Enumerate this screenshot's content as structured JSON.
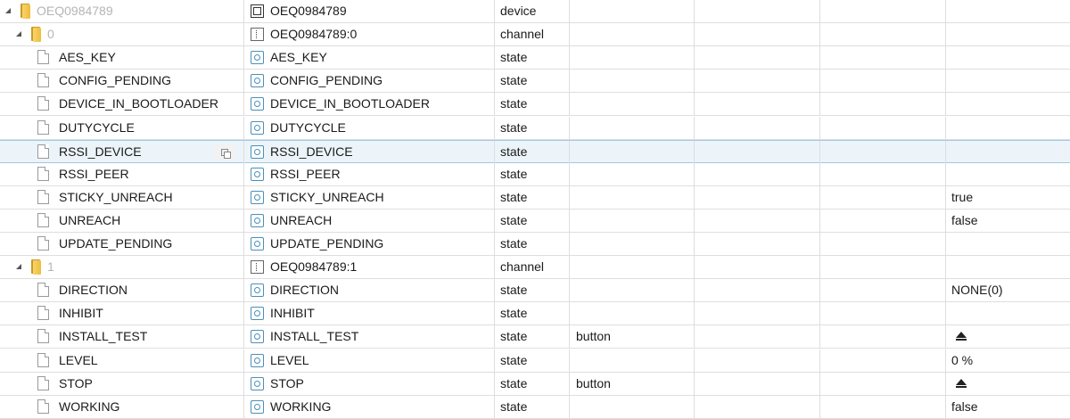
{
  "rows": [
    {
      "kind": "device",
      "name": "OEQ0984789",
      "id": "OEQ0984789",
      "type": "device",
      "role": "",
      "value": ""
    },
    {
      "kind": "channel",
      "name": "0",
      "id": "OEQ0984789:0",
      "type": "channel",
      "role": "",
      "value": ""
    },
    {
      "kind": "state",
      "name": "AES_KEY",
      "id": "AES_KEY",
      "type": "state",
      "role": "",
      "value": ""
    },
    {
      "kind": "state",
      "name": "CONFIG_PENDING",
      "id": "CONFIG_PENDING",
      "type": "state",
      "role": "",
      "value": ""
    },
    {
      "kind": "state",
      "name": "DEVICE_IN_BOOTLOADER",
      "id": "DEVICE_IN_BOOTLOADER",
      "type": "state",
      "role": "",
      "value": ""
    },
    {
      "kind": "state",
      "name": "DUTYCYCLE",
      "id": "DUTYCYCLE",
      "type": "state",
      "role": "",
      "value": ""
    },
    {
      "kind": "state",
      "name": "RSSI_DEVICE",
      "id": "RSSI_DEVICE",
      "type": "state",
      "role": "",
      "value": "",
      "selected": true
    },
    {
      "kind": "state",
      "name": "RSSI_PEER",
      "id": "RSSI_PEER",
      "type": "state",
      "role": "",
      "value": ""
    },
    {
      "kind": "state",
      "name": "STICKY_UNREACH",
      "id": "STICKY_UNREACH",
      "type": "state",
      "role": "",
      "value": "true"
    },
    {
      "kind": "state",
      "name": "UNREACH",
      "id": "UNREACH",
      "type": "state",
      "role": "",
      "value": "false"
    },
    {
      "kind": "state",
      "name": "UPDATE_PENDING",
      "id": "UPDATE_PENDING",
      "type": "state",
      "role": "",
      "value": ""
    },
    {
      "kind": "channel",
      "name": "1",
      "id": "OEQ0984789:1",
      "type": "channel",
      "role": "",
      "value": ""
    },
    {
      "kind": "state",
      "name": "DIRECTION",
      "id": "DIRECTION",
      "type": "state",
      "role": "",
      "value": "NONE(0)"
    },
    {
      "kind": "state",
      "name": "INHIBIT",
      "id": "INHIBIT",
      "type": "state",
      "role": "",
      "value": ""
    },
    {
      "kind": "state",
      "name": "INSTALL_TEST",
      "id": "INSTALL_TEST",
      "type": "state",
      "role": "button",
      "value": "",
      "value_icon": "eject-icon"
    },
    {
      "kind": "state",
      "name": "LEVEL",
      "id": "LEVEL",
      "type": "state",
      "role": "",
      "value": "0 %"
    },
    {
      "kind": "state",
      "name": "STOP",
      "id": "STOP",
      "type": "state",
      "role": "button",
      "value": "",
      "value_icon": "eject-icon"
    },
    {
      "kind": "state",
      "name": "WORKING",
      "id": "WORKING",
      "type": "state",
      "role": "",
      "value": "false"
    }
  ]
}
